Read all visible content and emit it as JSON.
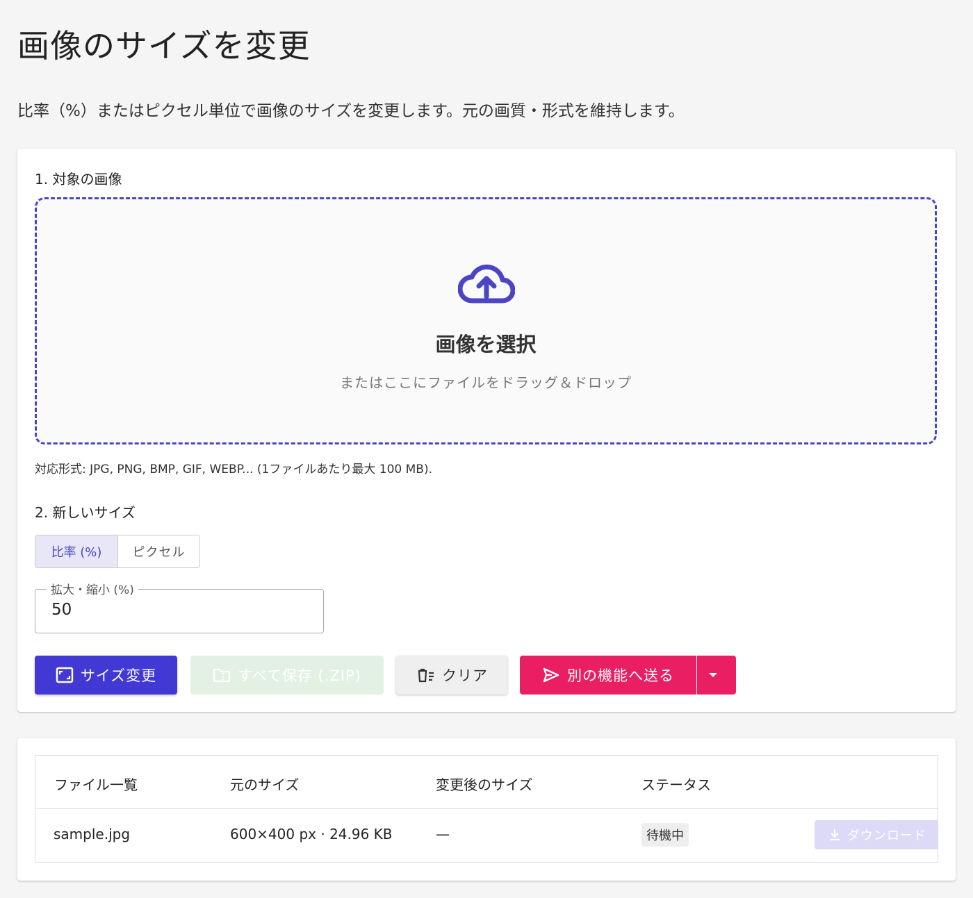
{
  "page": {
    "title": "画像のサイズを変更",
    "description": "比率（%）またはピクセル単位で画像のサイズを変更します。元の画質・形式を維持します。"
  },
  "upload": {
    "section_label": "1. 対象の画像",
    "title": "画像を選択",
    "subtitle": "またはここにファイルをドラッグ＆ドロップ",
    "formats": "対応形式: JPG, PNG, BMP, GIF, WEBP... (1ファイルあたり最大 100 MB).",
    "icon": "cloud-upload-icon"
  },
  "size": {
    "section_label": "2. 新しいサイズ",
    "modes": [
      "比率 (%)",
      "ピクセル"
    ],
    "active_mode": "比率 (%)",
    "scale_label": "拡大・縮小 (%)",
    "scale_value": "50"
  },
  "actions": {
    "resize": "サイズ変更",
    "save_all": "すべて保存 (.ZIP)",
    "clear": "クリア",
    "send": "別の機能へ送る"
  },
  "table": {
    "headers": [
      "ファイル一覧",
      "元のサイズ",
      "変更後のサイズ",
      "ステータス"
    ],
    "rows": [
      {
        "file": "sample.jpg",
        "original": "600×400 px · 24.96 KB",
        "resized": "—",
        "status": "待機中",
        "download": "ダウンロード"
      }
    ]
  },
  "colors": {
    "primary": "#4238d3",
    "accent": "#e91e63",
    "dropzone_border": "#4b45c6"
  }
}
